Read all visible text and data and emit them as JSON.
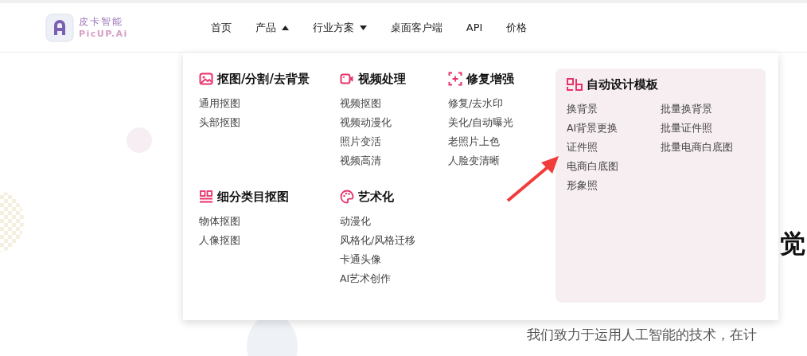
{
  "logo": {
    "name": "皮卡智能",
    "subtitle": "PicUP.Ai"
  },
  "nav": [
    {
      "label": "首页",
      "kind": "link"
    },
    {
      "label": "产品",
      "kind": "dropdown",
      "expanded": true
    },
    {
      "label": "行业方案",
      "kind": "dropdown",
      "expanded": false
    },
    {
      "label": "桌面客户端",
      "kind": "link"
    },
    {
      "label": "API",
      "kind": "link"
    },
    {
      "label": "价格",
      "kind": "link"
    }
  ],
  "menu": {
    "groups": [
      {
        "title": "抠图/分割/去背景",
        "items": [
          "通用抠图",
          "头部抠图"
        ]
      },
      {
        "title": "视频处理",
        "items": [
          "视频抠图",
          "视频动漫化",
          "照片变活",
          "视频高清"
        ]
      },
      {
        "title": "修复增强",
        "items": [
          "修复/去水印",
          "美化/自动曝光",
          "老照片上色",
          "人脸变清晰"
        ]
      },
      {
        "title": "细分类目抠图",
        "items": [
          "物体抠图",
          "人像抠图"
        ]
      },
      {
        "title": "艺术化",
        "items": [
          "动漫化",
          "风格化/风格迁移",
          "卡通头像",
          "AI艺术创作"
        ]
      }
    ],
    "featured": {
      "title": "自动设计模板",
      "columns": [
        [
          "换背景",
          "AI背景更换",
          "证件照",
          "电商白底图",
          "形象照"
        ],
        [
          "批量换背景",
          "批量证件照",
          "批量电商白底图"
        ]
      ]
    }
  },
  "hero": {
    "title": "觉",
    "subtitle": "我们致力于运用人工智能的技术，在计"
  }
}
